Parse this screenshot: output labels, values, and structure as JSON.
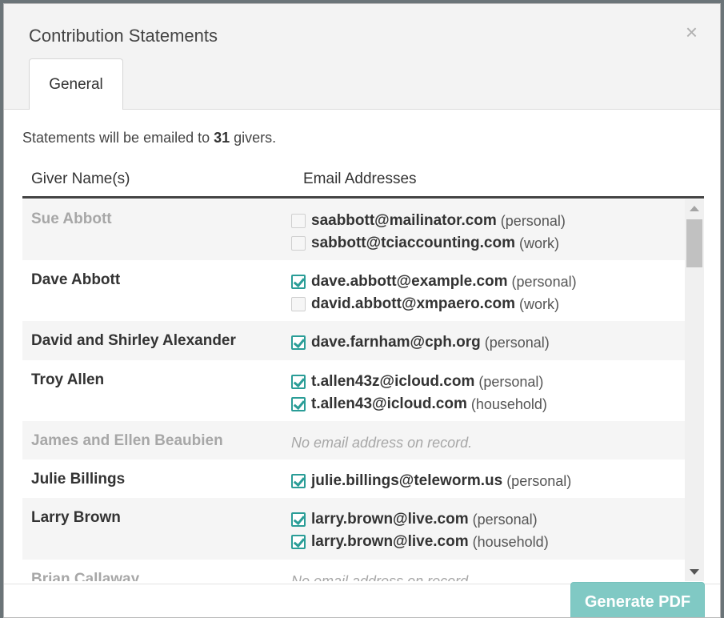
{
  "modal": {
    "title": "Contribution Statements",
    "close_label": "×",
    "tabs": [
      {
        "label": "General"
      }
    ]
  },
  "summary": {
    "prefix": "Statements will be emailed to ",
    "count": "31",
    "suffix": " givers."
  },
  "table": {
    "headers": {
      "name": "Giver Name(s)",
      "emails": "Email Addresses"
    },
    "empty_email_text": "No email address on record."
  },
  "givers": [
    {
      "name": "Sue Abbott",
      "muted": true,
      "emails": [
        {
          "address": "saabbott@mailinator.com",
          "type": "(personal)",
          "checked": false
        },
        {
          "address": "sabbott@tciaccounting.com",
          "type": "(work)",
          "checked": false
        }
      ]
    },
    {
      "name": "Dave Abbott",
      "muted": false,
      "emails": [
        {
          "address": "dave.abbott@example.com",
          "type": "(personal)",
          "checked": true
        },
        {
          "address": "david.abbott@xmpaero.com",
          "type": "(work)",
          "checked": false
        }
      ]
    },
    {
      "name": "David and Shirley Alexander",
      "muted": false,
      "emails": [
        {
          "address": "dave.farnham@cph.org",
          "type": "(personal)",
          "checked": true
        }
      ]
    },
    {
      "name": "Troy Allen",
      "muted": false,
      "emails": [
        {
          "address": "t.allen43z@icloud.com",
          "type": "(personal)",
          "checked": true
        },
        {
          "address": "t.allen43@icloud.com",
          "type": "(household)",
          "checked": true
        }
      ]
    },
    {
      "name": "James and Ellen Beaubien",
      "muted": true,
      "emails": []
    },
    {
      "name": "Julie Billings",
      "muted": false,
      "emails": [
        {
          "address": "julie.billings@teleworm.us",
          "type": "(personal)",
          "checked": true
        }
      ]
    },
    {
      "name": "Larry Brown",
      "muted": false,
      "emails": [
        {
          "address": "larry.brown@live.com",
          "type": "(personal)",
          "checked": true
        },
        {
          "address": "larry.brown@live.com",
          "type": "(household)",
          "checked": true
        }
      ]
    },
    {
      "name": "Brian Callaway",
      "muted": true,
      "emails": []
    }
  ],
  "footer": {
    "generate_label": "Generate PDF"
  },
  "colors": {
    "accent": "#2a9d97",
    "button": "#80c9c4",
    "muted_text": "#a7a7a7"
  }
}
